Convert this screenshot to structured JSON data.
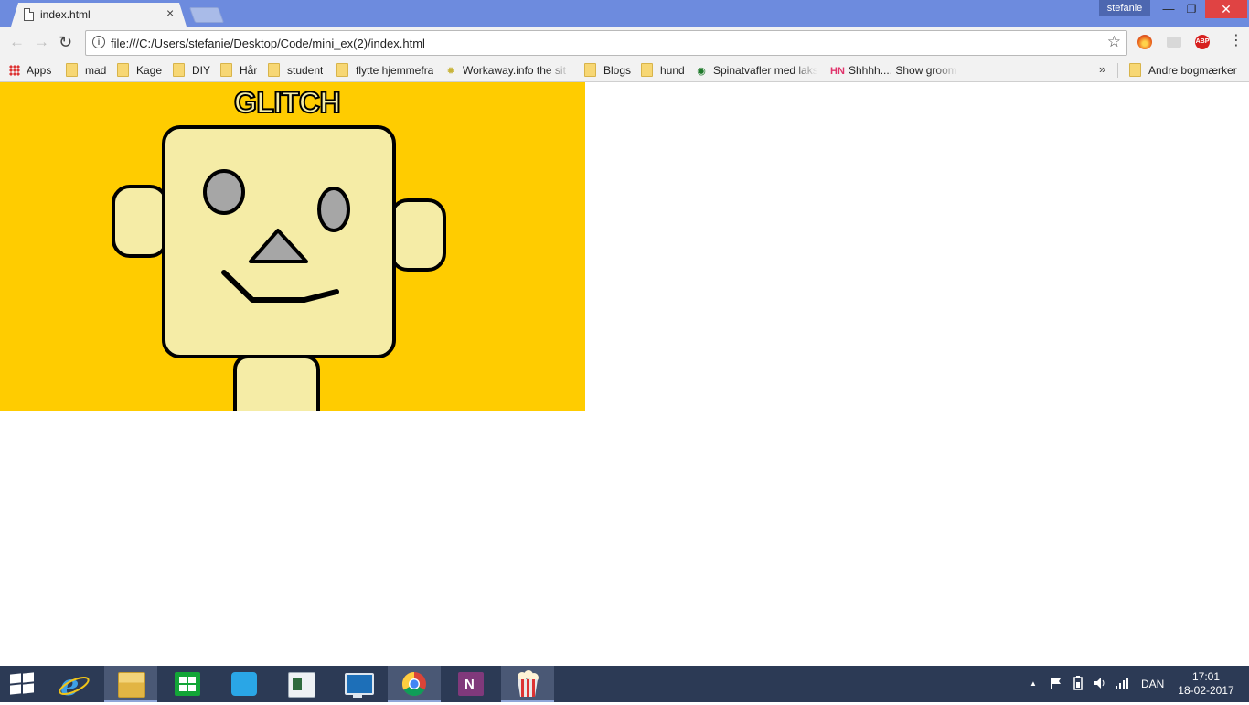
{
  "browser": {
    "tab_title": "index.html",
    "tab_close": "×",
    "profile_name": "stefanie",
    "window_controls": {
      "minimize": "—",
      "maximize": "❐",
      "close": "✕"
    },
    "nav": {
      "back": "←",
      "forward": "→",
      "reload": "↻"
    },
    "url": "file:///C:/Users/stefanie/Desktop/Code/mini_ex(2)/index.html",
    "info_symbol": "i",
    "star": "☆",
    "abp_label": "ABP",
    "menu": "⋮"
  },
  "bookmarks": {
    "items": [
      {
        "label": "Apps",
        "icon": "apps-grid-icon"
      },
      {
        "label": "mad",
        "icon": "folder-icon"
      },
      {
        "label": "Kage",
        "icon": "folder-icon"
      },
      {
        "label": "DIY",
        "icon": "folder-icon"
      },
      {
        "label": "Hår",
        "icon": "folder-icon"
      },
      {
        "label": "student",
        "icon": "folder-icon"
      },
      {
        "label": "flytte hjemmefra",
        "icon": "folder-icon"
      },
      {
        "label": "Workaway.info the sit",
        "icon": "workaway-icon"
      },
      {
        "label": "Blogs",
        "icon": "folder-icon"
      },
      {
        "label": "hund",
        "icon": "folder-icon"
      },
      {
        "label": "Spinatvafler med laks",
        "icon": "site-icon"
      },
      {
        "label": "Shhhh.... Show groom",
        "icon": "hn-icon"
      }
    ],
    "overflow": "»",
    "other_bookmarks": "Andre bogmærker",
    "hn_mark": "HN"
  },
  "page": {
    "background_color": "#ffcc00",
    "title": "GLITCH",
    "robot_fill": "#f5eca6",
    "eye_fill": "#a6a6a6",
    "nose_fill": "#a6a6a6"
  },
  "taskbar": {
    "lang": "DAN",
    "time": "17:01",
    "date": "18-02-2017",
    "tray_up": "▲",
    "apps": [
      "start-icon",
      "internet-explorer-icon",
      "file-explorer-icon",
      "store-icon",
      "shopping-icon",
      "reader-icon",
      "lenovo-icon",
      "chrome-icon",
      "onenote-icon",
      "popcorn-icon"
    ]
  }
}
